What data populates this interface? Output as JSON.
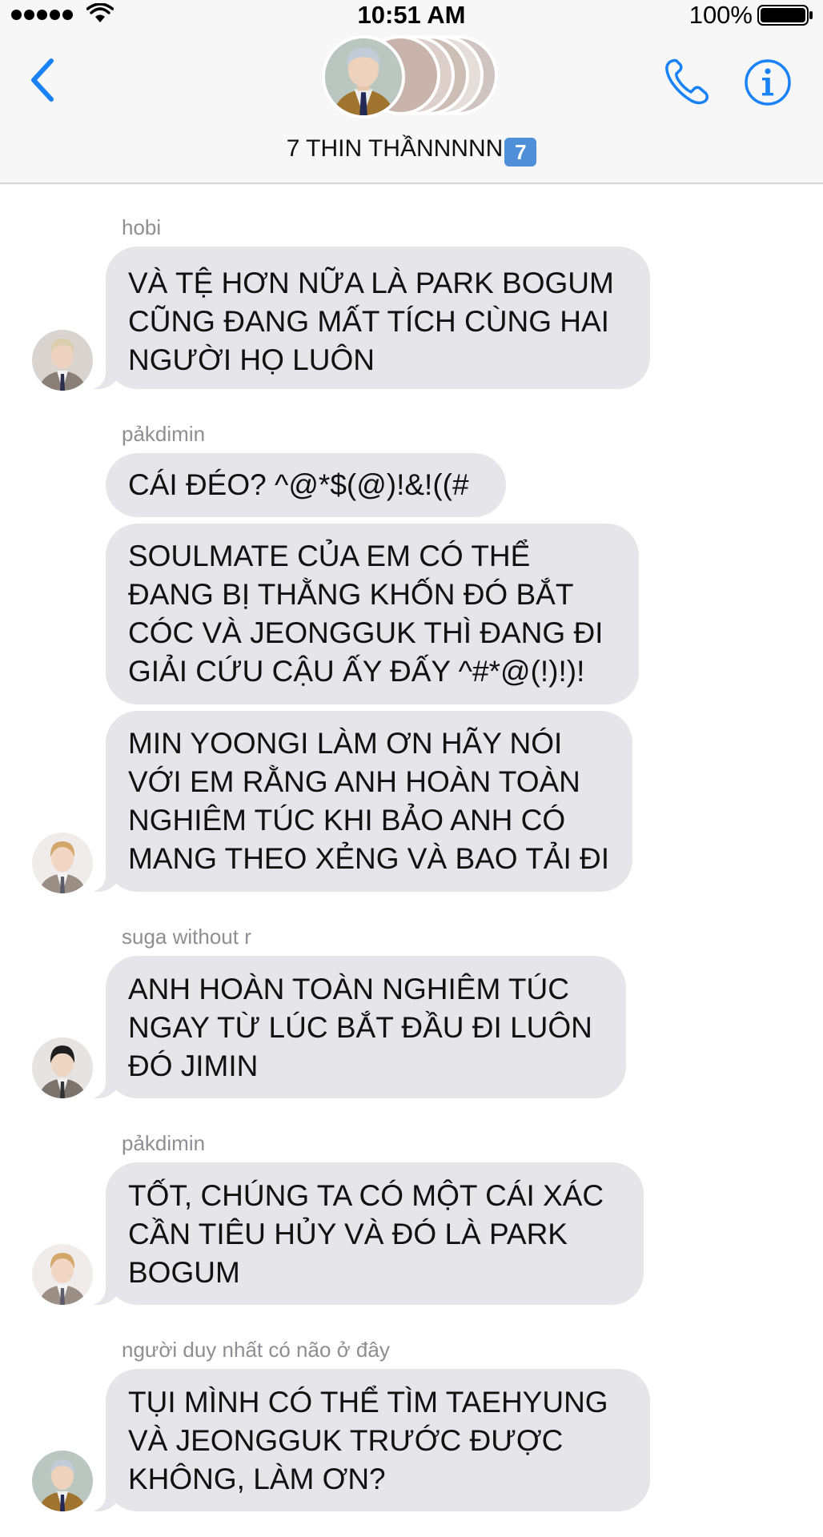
{
  "status_bar": {
    "time": "10:51 AM",
    "battery_percent": "100%",
    "signal_bars": 5,
    "battery_level": 1.0
  },
  "header": {
    "title": "7 THIN THẦNNNNN",
    "title_badge": "7",
    "back_icon": "chevron-left-icon",
    "call_icon": "phone-icon",
    "info_icon": "info-icon",
    "accent_color": "#1a82f7"
  },
  "messages": [
    {
      "sender": "hobi",
      "avatar": "avatar-hobi",
      "bubbles": [
        {
          "lines": [
            "VÀ TỆ HƠN NỮA LÀ PARK BOGUM",
            "CŨNG ĐANG MẤT TÍCH CÙNG HAI",
            "NGƯỜI HỌ LUÔN"
          ]
        }
      ]
    },
    {
      "sender": "pảkdimin",
      "avatar": "avatar-jimin",
      "bubbles": [
        {
          "lines": [
            "CÁI ĐÉO? ^@*$(@)!&!((#"
          ]
        },
        {
          "lines": [
            "SOULMATE CỦA EM CÓ THỂ",
            "ĐANG BỊ THẰNG KHỐN ĐÓ BẮT",
            "CÓC VÀ JEONGGUK THÌ ĐANG ĐI",
            "GIẢI CỨU CẬU ẤY ĐẤY ^#*@(!)!)!"
          ]
        },
        {
          "lines": [
            "MIN YOONGI LÀM ƠN HÃY NÓI",
            "VỚI EM RẰNG ANH HOÀN TOÀN",
            "NGHIÊM TÚC KHI BẢO ANH CÓ",
            "MANG THEO XẺNG VÀ BAO TẢI ĐI"
          ]
        }
      ]
    },
    {
      "sender": "suga without r",
      "avatar": "avatar-suga",
      "bubbles": [
        {
          "lines": [
            "ANH HOÀN TOÀN NGHIÊM TÚC",
            "NGAY TỪ LÚC BẮT ĐẦU ĐI LUÔN",
            "ĐÓ JIMIN"
          ]
        }
      ]
    },
    {
      "sender": "pảkdimin",
      "avatar": "avatar-jimin",
      "bubbles": [
        {
          "lines": [
            "TỐT, CHÚNG TA CÓ MỘT CÁI XÁC",
            "CẦN TIÊU HỦY VÀ ĐÓ LÀ PARK",
            "BOGUM"
          ]
        }
      ]
    },
    {
      "sender": "người duy nhất có não ở đây",
      "avatar": "avatar-namjoon",
      "bubbles": [
        {
          "lines": [
            "TỤI MÌNH CÓ THỂ TÌM TAEHYUNG",
            "VÀ JEONGGUK TRƯỚC ĐƯỢC",
            "KHÔNG, LÀM ƠN?"
          ]
        }
      ]
    }
  ]
}
